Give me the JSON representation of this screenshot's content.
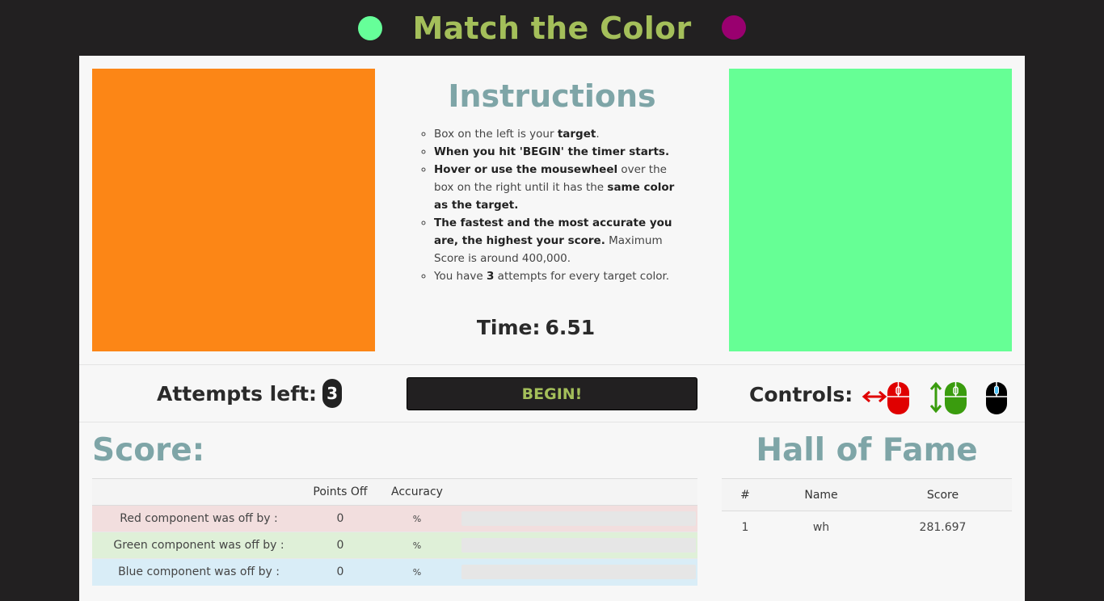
{
  "app": {
    "title": "Match the Color",
    "dot_left_color": "#66ff99",
    "dot_right_color": "#99006f"
  },
  "swatches": {
    "target_color": "#fc8616",
    "player_color": "#66ff95"
  },
  "instructions": {
    "title": "Instructions",
    "items": [
      [
        {
          "t": "Box on the left is your "
        },
        {
          "t": "target",
          "b": true
        },
        {
          "t": "."
        }
      ],
      [
        {
          "t": "When you hit 'BEGIN' the timer starts.",
          "b": true
        }
      ],
      [
        {
          "t": "Hover or use the mousewheel",
          "b": true
        },
        {
          "t": " over the box on the right until it has the "
        },
        {
          "t": "same color as the target.",
          "b": true
        }
      ],
      [
        {
          "t": "The fastest and the most accurate you are, the highest your score.",
          "b": true
        },
        {
          "t": " Maximum Score is around 400,000."
        }
      ],
      [
        {
          "t": "You have "
        },
        {
          "t": "3",
          "b": true
        },
        {
          "t": " attempts for every target color."
        }
      ]
    ]
  },
  "timer": {
    "label": "Time:",
    "value": "6.51"
  },
  "attempts": {
    "label": "Attempts left:",
    "count": "3"
  },
  "begin_button": {
    "label": "BEGIN!"
  },
  "controls": {
    "label": "Controls:",
    "icons": [
      {
        "name": "mouse-horizontal-red-icon",
        "color": "#e00000"
      },
      {
        "name": "mouse-vertical-green-icon",
        "color": "#3a9c0e"
      },
      {
        "name": "mouse-wheel-black-icon",
        "color": "#000000"
      }
    ]
  },
  "score": {
    "title": "Score:",
    "headers": [
      "",
      "Points Off",
      "Accuracy",
      ""
    ],
    "rows": [
      {
        "label": "Red component was off by :",
        "points": "0",
        "accuracy": "%",
        "fill": 0
      },
      {
        "label": "Green component was off by :",
        "points": "0",
        "accuracy": "%",
        "fill": 0
      },
      {
        "label": "Blue component was off by :",
        "points": "0",
        "accuracy": "%",
        "fill": 0
      }
    ]
  },
  "hall_of_fame": {
    "title": "Hall of Fame",
    "headers": [
      "#",
      "Name",
      "Score"
    ],
    "rows": [
      {
        "rank": "1",
        "name": "wh",
        "score": "281.697"
      }
    ]
  }
}
